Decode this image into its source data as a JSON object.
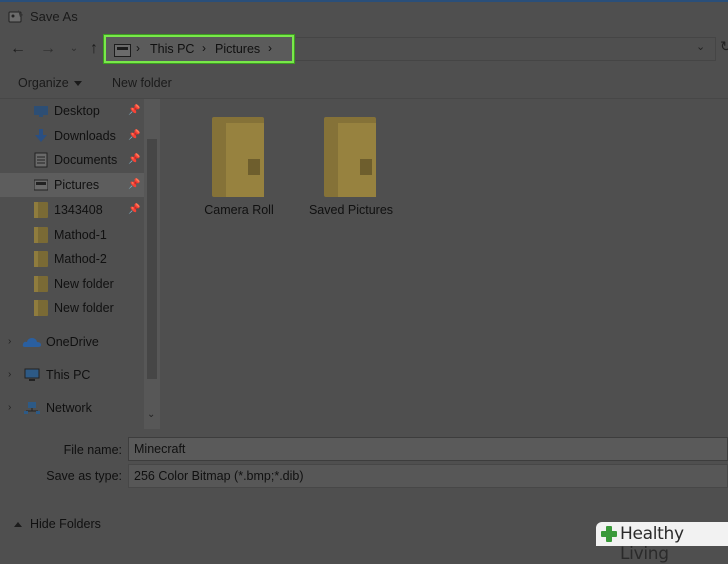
{
  "window": {
    "title": "Save As"
  },
  "address_bar": {
    "crumbs": [
      "This PC",
      "Pictures"
    ]
  },
  "toolbar": {
    "organize_label": "Organize",
    "new_folder_label": "New folder"
  },
  "sidebar": {
    "quick_access": [
      {
        "label": "Desktop",
        "icon": "desktop-icon",
        "pinned": true
      },
      {
        "label": "Downloads",
        "icon": "download-icon",
        "pinned": true
      },
      {
        "label": "Documents",
        "icon": "documents-icon",
        "pinned": true
      },
      {
        "label": "Pictures",
        "icon": "pictures-icon",
        "pinned": true,
        "selected": true
      },
      {
        "label": "1343408",
        "icon": "folder-icon",
        "pinned": true
      },
      {
        "label": "Mathod-1",
        "icon": "folder-icon",
        "pinned": false
      },
      {
        "label": "Mathod-2",
        "icon": "folder-icon",
        "pinned": false
      },
      {
        "label": "New folder",
        "icon": "folder-icon",
        "pinned": false
      },
      {
        "label": "New folder",
        "icon": "folder-icon",
        "pinned": false
      }
    ],
    "locations": [
      {
        "label": "OneDrive",
        "icon": "cloud-icon"
      },
      {
        "label": "This PC",
        "icon": "computer-icon"
      },
      {
        "label": "Network",
        "icon": "network-icon"
      }
    ]
  },
  "content": {
    "folders": [
      {
        "label": "Camera Roll"
      },
      {
        "label": "Saved Pictures"
      }
    ]
  },
  "form": {
    "file_name_label": "File name:",
    "file_name_value": "Minecraft",
    "save_type_label": "Save as type:",
    "save_type_value": "256 Color Bitmap (*.bmp;*.dib)"
  },
  "footer": {
    "hide_folders_label": "Hide Folders"
  },
  "watermark": {
    "text": "Healthy Living"
  },
  "colors": {
    "highlight_border": "#79e84a",
    "dimmed_background": "#4f4f4f",
    "watermark_green": "#3a9a3a"
  }
}
